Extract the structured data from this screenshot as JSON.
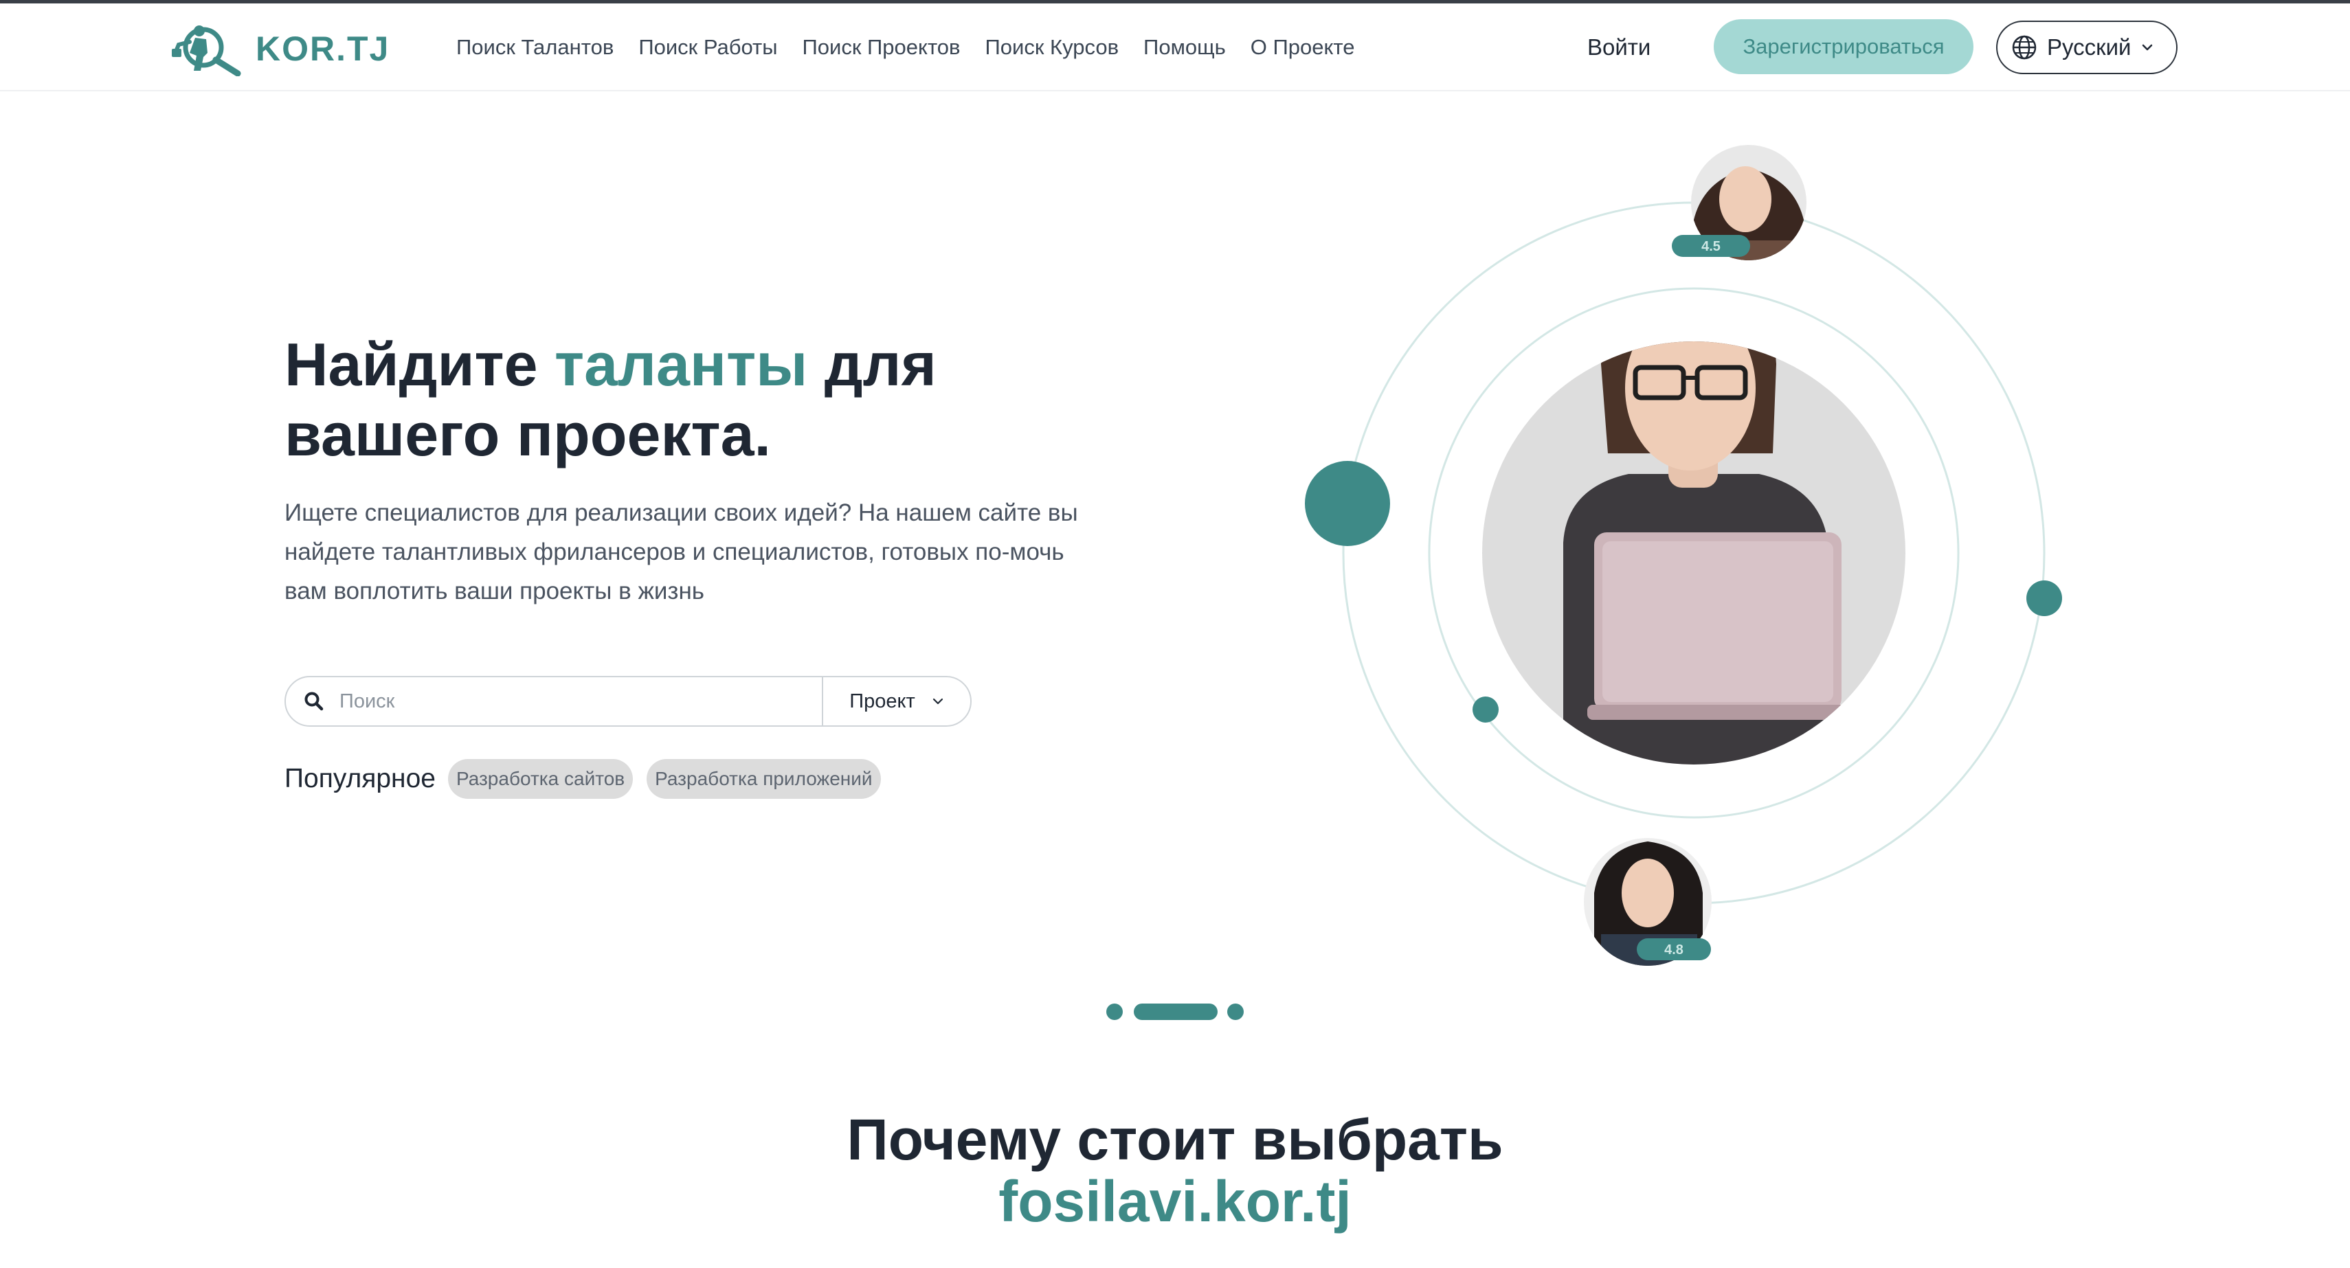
{
  "brand": {
    "logo_text": "KOR.TJ",
    "accent_color": "#3e8a87",
    "light_accent": "#a4d8d4"
  },
  "nav": {
    "items": [
      {
        "label": "Поиск Талантов"
      },
      {
        "label": "Поиск Работы"
      },
      {
        "label": "Поиск Проектов"
      },
      {
        "label": "Поиск Курсов"
      },
      {
        "label": "Помощь"
      },
      {
        "label": "О Проекте"
      }
    ],
    "login_label": "Войти",
    "register_label": "Зарегистрироваться",
    "language": {
      "selected": "Русский",
      "icon": "globe-icon"
    }
  },
  "hero": {
    "title_part1": "Найдите ",
    "title_accent": "таланты",
    "title_part2": " для",
    "title_line2": "вашего проекта.",
    "description": "Ищете специалистов для реализации своих идей? На нашем сайте вы найдете талантливых фрилансеров и специалистов, готовых по-мочь вам воплотить ваши проекты в жизнь",
    "search": {
      "placeholder": "Поиск",
      "value": "",
      "type_selected": "Проект",
      "icon": "search-icon"
    },
    "popular": {
      "label": "Популярное",
      "tags": [
        {
          "label": "Разработка сайтов"
        },
        {
          "label": "Разработка приложений"
        }
      ]
    }
  },
  "illustration": {
    "ratings": [
      {
        "value": "4.5"
      },
      {
        "value": "4.8"
      }
    ]
  },
  "carousel": {
    "slide_count": 3,
    "active_index": 1
  },
  "why_section": {
    "line1": "Почему стоит выбрать",
    "line2": "fosilavi.kor.tj"
  }
}
